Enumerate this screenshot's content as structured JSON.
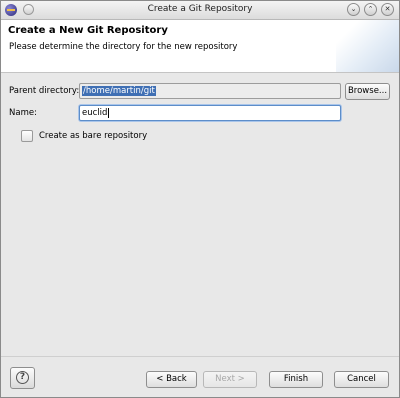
{
  "window": {
    "title": "Create a Git Repository"
  },
  "header": {
    "title": "Create a New Git Repository",
    "description": "Please determine the directory for the new repository"
  },
  "form": {
    "parent_label": "Parent directory:",
    "parent_value": "/home/martin/git",
    "browse_label": "Browse...",
    "name_label": "Name:",
    "name_value": "euclid",
    "bare_label": "Create as bare repository",
    "bare_checked": false
  },
  "footer": {
    "back_label": "< Back",
    "next_label": "Next >",
    "finish_label": "Finish",
    "cancel_label": "Cancel"
  }
}
